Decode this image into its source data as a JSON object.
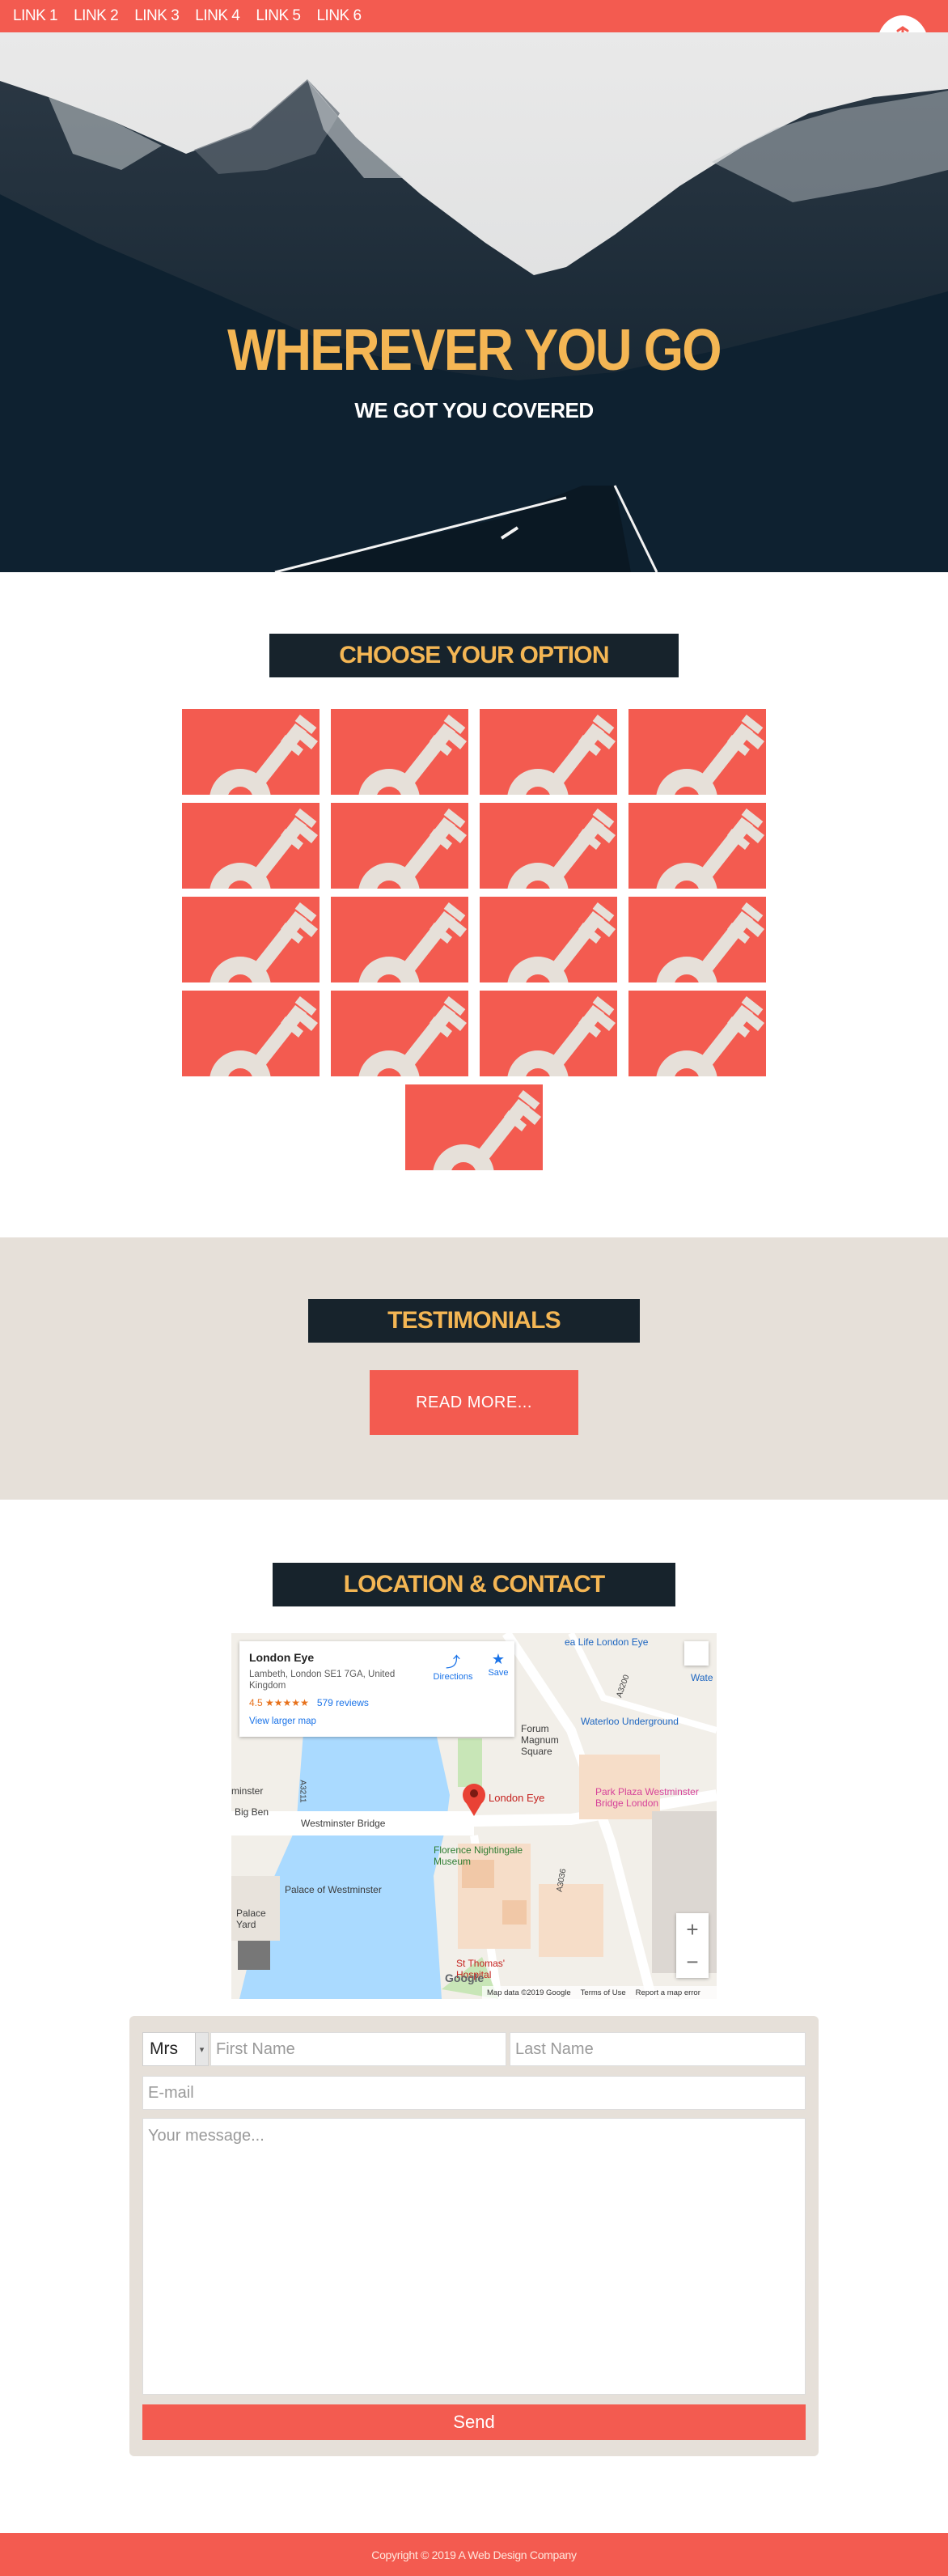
{
  "nav": {
    "links": [
      "LINK 1",
      "LINK 2",
      "LINK 3",
      "LINK 4",
      "LINK 5",
      "LINK 6"
    ],
    "logo_icon": "compass-rose-icon",
    "color": "#f35b50"
  },
  "hero": {
    "title": "WHEREVER YOU GO",
    "subtitle": "WE GOT YOU COVERED"
  },
  "options": {
    "title": "CHOOSE YOUR OPTION",
    "tile_icon": "key-icon",
    "tile_count": 17
  },
  "testimonials": {
    "title": "TESTIMONIALS",
    "button": "READ MORE..."
  },
  "contact": {
    "title": "LOCATION & CONTACT",
    "map": {
      "place_name": "London Eye",
      "address": "Lambeth, London SE1 7GA, United Kingdom",
      "rating": "4.5",
      "stars": "★★★★★",
      "reviews": "579 reviews",
      "view_larger": "View larger map",
      "directions": "Directions",
      "save": "Save",
      "zoom_in": "+",
      "zoom_out": "−",
      "attribution": "Map data ©2019 Google",
      "terms": "Terms of Use",
      "report": "Report a map error",
      "google": "Google",
      "labels": {
        "pin": "London Eye",
        "waterloo": "Waterloo Underground",
        "park_plaza": "Park Plaza Westminster Bridge London",
        "westminster": "Westminster Bridge",
        "big_ben": "Big Ben",
        "westminster_tube": "minster",
        "florence": "Florence Nightingale Museum",
        "palace": "Palace of Westminster",
        "palace_yard": "Palace Yard",
        "forum": "Forum Magnum Square",
        "st_thomas": "St Thomas' Hospital",
        "sea_life": "ea Life London Eye",
        "wat": "Wate",
        "a3200": "A3200",
        "a3211": "A3211",
        "a3036": "A3036"
      }
    },
    "form": {
      "title_select": "Mrs",
      "first_name_placeholder": "First Name",
      "last_name_placeholder": "Last Name",
      "email_placeholder": "E-mail",
      "message_placeholder": "Your message...",
      "send": "Send"
    }
  },
  "footer": {
    "copyright": "Copyright © 2019 A Web Design Company"
  }
}
